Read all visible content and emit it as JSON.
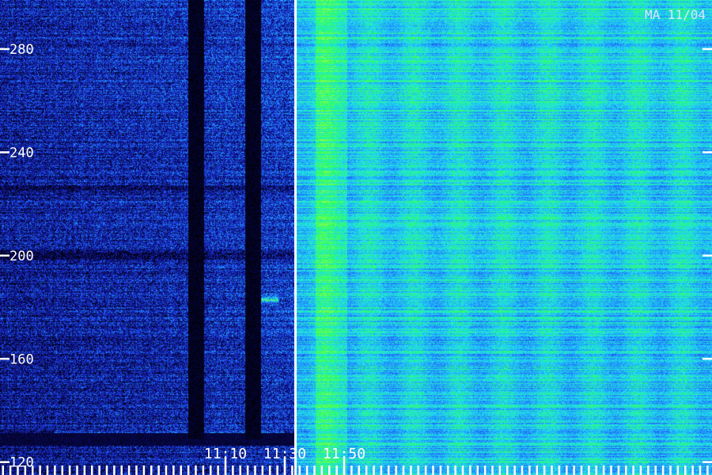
{
  "chart_data": {
    "type": "heatmap",
    "title": "MA 11/04",
    "xlabel": "",
    "ylabel": "",
    "x_ticks": [
      "11:10",
      "11:30",
      "11:50"
    ],
    "x_range_minutes": [
      9.9,
      13.9
    ],
    "y_ticks": [
      120,
      160,
      200,
      240,
      280
    ],
    "ylim": [
      115,
      299
    ],
    "colormap": [
      "#000000",
      "#0a0a6e",
      "#1c2fd6",
      "#1f8fff",
      "#22e0f0",
      "#28ff60",
      "#a8ff40"
    ],
    "gaps_minutes": [
      11.0,
      11.32
    ],
    "event_start_minute": 11.56,
    "bright_bands_hz": [
      {
        "center": 183,
        "from_minute": 11.28,
        "to_minute": 11.46,
        "level": 0.8
      },
      {
        "center": 131,
        "from_minute": 10.2,
        "to_minute": 11.5,
        "level": 0.45
      }
    ],
    "marker_line_minute": 11.56
  },
  "colors": {
    "tick": "#ffffff",
    "label": "#ffffff",
    "title": "#d8e6ff",
    "marker": "#ffffff"
  }
}
